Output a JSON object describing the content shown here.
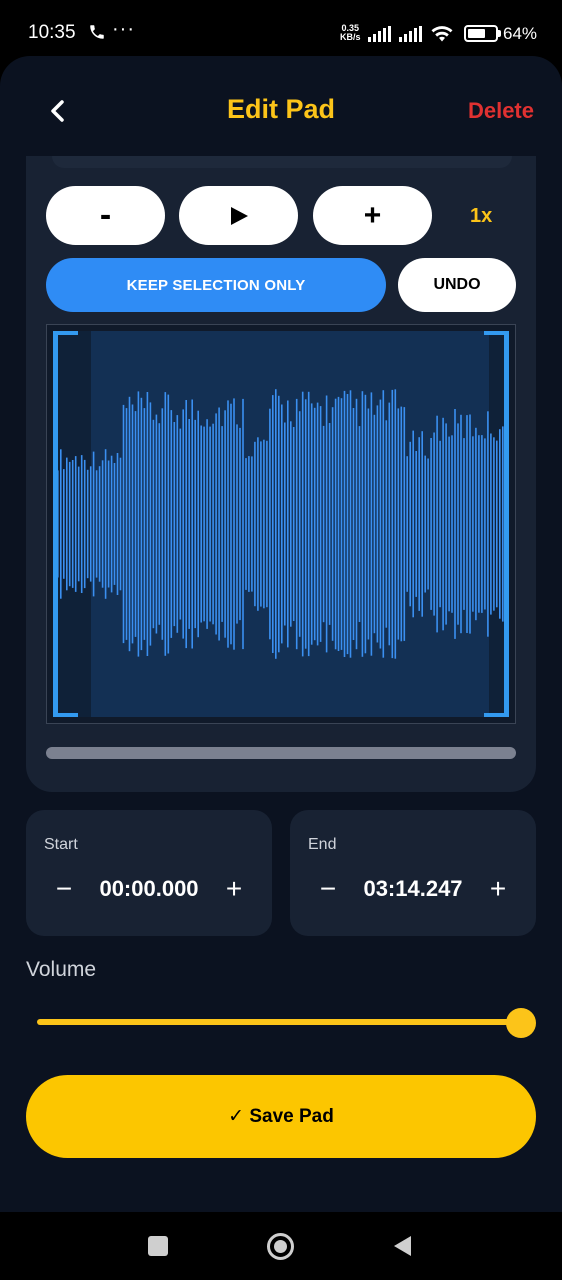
{
  "status_bar": {
    "time": "10:35",
    "dots": "···",
    "net_speed_value": "0.35",
    "net_speed_unit": "KB/s",
    "battery_percent": "64%",
    "battery_level": 0.64
  },
  "header": {
    "back_icon": "chevron-left-icon",
    "title": "Edit Pad",
    "delete_label": "Delete"
  },
  "editor": {
    "zoom_out_label": "-",
    "play_icon": "play-icon",
    "zoom_in_label": "+",
    "zoom_level": "1x",
    "keep_selection_label": "KEEP SELECTION ONLY",
    "undo_label": "UNDO"
  },
  "start": {
    "label": "Start",
    "value": "00:00.000",
    "decrement": "−",
    "increment": "+"
  },
  "end": {
    "label": "End",
    "value": "03:14.247",
    "decrement": "−",
    "increment": "+"
  },
  "volume": {
    "label": "Volume",
    "level": 1.0
  },
  "save": {
    "label": "✓ Save Pad"
  },
  "colors": {
    "accent_yellow": "#fcc419",
    "accent_blue": "#339af0",
    "danger_red": "#e03131",
    "background": "#0b1220",
    "card": "#182233"
  }
}
